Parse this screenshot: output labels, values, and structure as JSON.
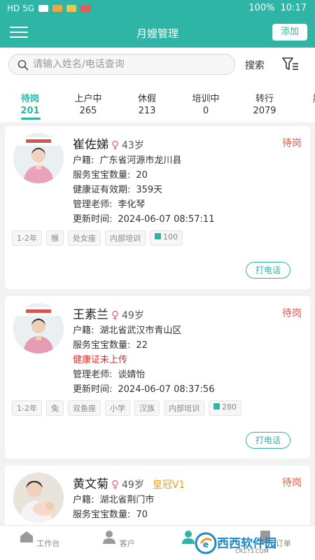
{
  "status_bar": {
    "left": "HD 5G",
    "battery": "100%",
    "time": "10:17"
  },
  "header": {
    "title": "月嫂管理",
    "add_label": "添加"
  },
  "search": {
    "placeholder": "请输入姓名/电话查询",
    "button_label": "搜索"
  },
  "tabs": [
    {
      "label": "待岗",
      "count": "201",
      "active": true
    },
    {
      "label": "上户中",
      "count": "265"
    },
    {
      "label": "休假",
      "count": "213"
    },
    {
      "label": "培训中",
      "count": "0"
    },
    {
      "label": "转行",
      "count": "2079"
    },
    {
      "label": "黑",
      "count": ""
    }
  ],
  "labels": {
    "hometown": "户籍:",
    "baby_count": "服务宝宝数量:",
    "health_valid": "健康证有效期:",
    "manager": "管理老师:",
    "updated": "更新时间:",
    "call": "打电话"
  },
  "cards": [
    {
      "name": "崔佐娣",
      "gender": "♀",
      "age": "43岁",
      "crown": "",
      "status": "待岗",
      "hometown": "广东省河源市龙川县",
      "baby_count": "20",
      "health_valid": "359天",
      "health_missing": "",
      "manager": "李化琴",
      "updated": "2024-06-07 08:57:11",
      "tags": [
        "1-2年",
        "猴",
        "处女座",
        "内部培训"
      ],
      "gift": "100"
    },
    {
      "name": "王素兰",
      "gender": "♀",
      "age": "49岁",
      "crown": "",
      "status": "待岗",
      "hometown": "湖北省武汉市青山区",
      "baby_count": "22",
      "health_valid": "",
      "health_missing": "健康证未上传",
      "manager": "谈婧怡",
      "updated": "2024-06-07 08:37:56",
      "tags": [
        "1-2年",
        "兔",
        "双鱼座",
        "小学",
        "汉族",
        "内部培训"
      ],
      "gift": "280"
    },
    {
      "name": "黄文菊",
      "gender": "♀",
      "age": "49岁",
      "crown": "皇冠V1",
      "status": "待岗",
      "hometown": "湖北省荆门市",
      "baby_count": "70"
    }
  ],
  "bottom_nav": [
    {
      "label": "工作台"
    },
    {
      "label": "客户"
    },
    {
      "label": "月嫂",
      "active": true
    },
    {
      "label": "订单"
    }
  ],
  "watermark": {
    "name": "西西软件园",
    "sub": "CR173.COM"
  },
  "colors": {
    "primary": "#2fb5a6",
    "status_red": "#e05548",
    "crown": "#e3a423"
  }
}
